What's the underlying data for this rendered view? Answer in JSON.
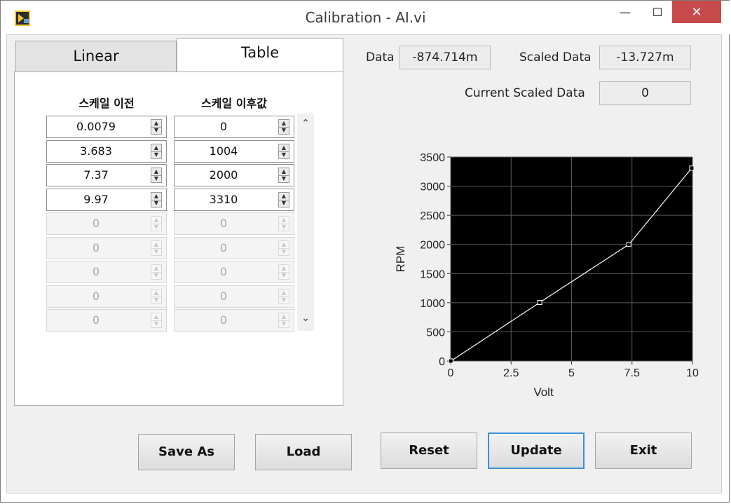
{
  "window": {
    "title": "Calibration - AI.vi"
  },
  "tabs": [
    {
      "label": "Linear"
    },
    {
      "label": "Table"
    }
  ],
  "table": {
    "headers": [
      "스케일 이전",
      "스케일 이후값"
    ],
    "rows": [
      [
        "0.0079",
        "0"
      ],
      [
        "3.683",
        "1004"
      ],
      [
        "7.37",
        "2000"
      ],
      [
        "9.97",
        "3310"
      ],
      [
        "0",
        "0"
      ],
      [
        "0",
        "0"
      ],
      [
        "0",
        "0"
      ],
      [
        "0",
        "0"
      ],
      [
        "0",
        "0"
      ]
    ],
    "active_rows": 4
  },
  "indicators": {
    "data_label": "Data",
    "data_value": "-874.714m",
    "scaled_label": "Scaled Data",
    "scaled_value": "-13.727m",
    "current_label": "Current Scaled Data",
    "current_value": "0"
  },
  "chart_data": {
    "type": "line",
    "xlabel": "Volt",
    "ylabel": "RPM",
    "x": [
      0.0079,
      3.683,
      7.37,
      9.97
    ],
    "y": [
      0,
      1004,
      2000,
      3310
    ],
    "xlim": [
      0,
      10
    ],
    "ylim": [
      0,
      3500
    ],
    "xticks": [
      "0",
      "2.5",
      "5",
      "7.5",
      "10"
    ],
    "yticks": [
      "0",
      "500",
      "1000",
      "1500",
      "2000",
      "2500",
      "3000",
      "3500"
    ],
    "grid": true,
    "background": "#000000",
    "line_color": "#ffffff"
  },
  "buttons": {
    "save_as": "Save As",
    "load": "Load",
    "reset": "Reset",
    "update": "Update",
    "exit": "Exit"
  },
  "window_controls": {
    "minimize": "—",
    "maximize": "☐",
    "close": "✕"
  }
}
